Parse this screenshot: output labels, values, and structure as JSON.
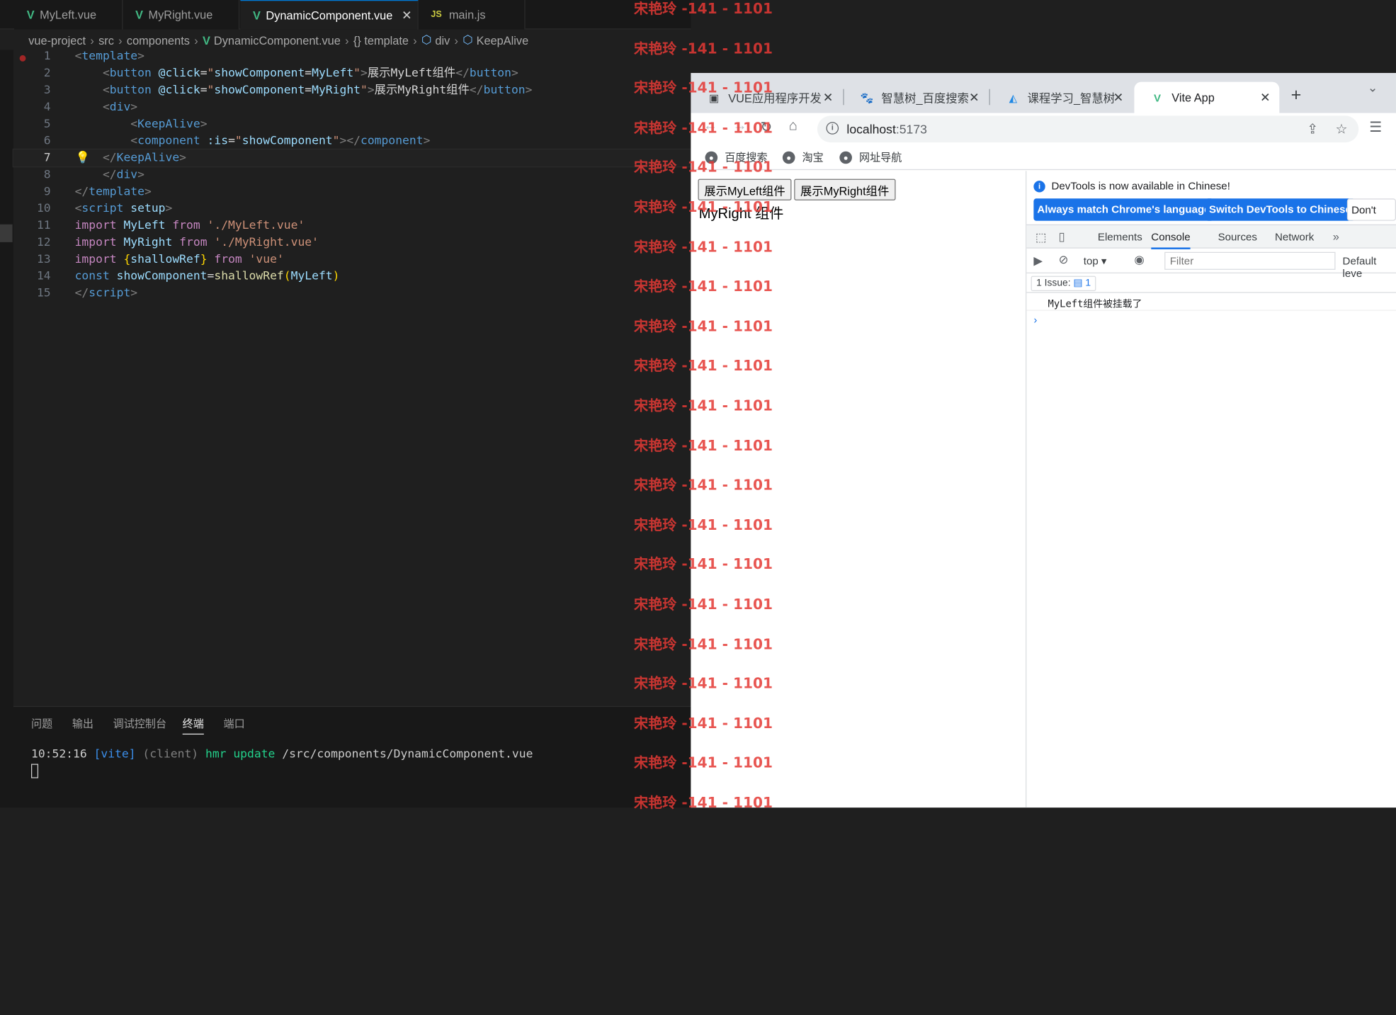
{
  "editor": {
    "tabs": [
      {
        "label": "MyLeft.vue",
        "icon": "vue-icon"
      },
      {
        "label": "MyRight.vue",
        "icon": "vue-icon"
      },
      {
        "label": "DynamicComponent.vue",
        "icon": "vue-icon",
        "active": true
      },
      {
        "label": "main.js",
        "icon": "js-icon",
        "icon_text": "JS"
      }
    ],
    "breadcrumb": [
      "vue-project",
      "src",
      "components",
      "DynamicComponent.vue",
      "{} template",
      "div",
      "KeepAlive"
    ],
    "code_lines": [
      {
        "n": "1",
        "parts": [
          [
            "tag",
            "<"
          ],
          [
            "tn",
            "template"
          ],
          [
            "tag",
            ">"
          ]
        ]
      },
      {
        "n": "2",
        "parts": [
          [
            "plain",
            "    "
          ],
          [
            "tag",
            "<"
          ],
          [
            "tn",
            "button"
          ],
          [
            "plain",
            " "
          ],
          [
            "at",
            "@click"
          ],
          [
            "plain",
            "="
          ],
          [
            "str",
            "\""
          ],
          [
            "id",
            "showComponent"
          ],
          [
            "plain",
            "="
          ],
          [
            "id",
            "MyLeft"
          ],
          [
            "str",
            "\""
          ],
          [
            "tag",
            ">"
          ],
          [
            "plain",
            "展示MyLeft组件"
          ],
          [
            "tag",
            "</"
          ],
          [
            "tn",
            "button"
          ],
          [
            "tag",
            ">"
          ]
        ]
      },
      {
        "n": "3",
        "parts": [
          [
            "plain",
            "    "
          ],
          [
            "tag",
            "<"
          ],
          [
            "tn",
            "button"
          ],
          [
            "plain",
            " "
          ],
          [
            "at",
            "@click"
          ],
          [
            "plain",
            "="
          ],
          [
            "str",
            "\""
          ],
          [
            "id",
            "showComponent"
          ],
          [
            "plain",
            "="
          ],
          [
            "id",
            "MyRight"
          ],
          [
            "str",
            "\""
          ],
          [
            "tag",
            ">"
          ],
          [
            "plain",
            "展示MyRight组件"
          ],
          [
            "tag",
            "</"
          ],
          [
            "tn",
            "button"
          ],
          [
            "tag",
            ">"
          ]
        ]
      },
      {
        "n": "4",
        "parts": [
          [
            "plain",
            "    "
          ],
          [
            "tag",
            "<"
          ],
          [
            "tn",
            "div"
          ],
          [
            "tag",
            ">"
          ]
        ]
      },
      {
        "n": "5",
        "parts": [
          [
            "plain",
            "        "
          ],
          [
            "tag",
            "<"
          ],
          [
            "tn",
            "KeepAlive"
          ],
          [
            "tag",
            ">"
          ]
        ]
      },
      {
        "n": "6",
        "parts": [
          [
            "plain",
            "        "
          ],
          [
            "tag",
            "<"
          ],
          [
            "tn",
            "component"
          ],
          [
            "plain",
            " "
          ],
          [
            "at",
            ":is"
          ],
          [
            "plain",
            "="
          ],
          [
            "str",
            "\""
          ],
          [
            "id",
            "showComponent"
          ],
          [
            "str",
            "\""
          ],
          [
            "tag",
            "></"
          ],
          [
            "tn",
            "component"
          ],
          [
            "tag",
            ">"
          ]
        ]
      },
      {
        "n": "7",
        "parts": [
          [
            "plain",
            "    "
          ],
          [
            "tag",
            "</"
          ],
          [
            "tn",
            "KeepAlive"
          ],
          [
            "tag",
            ">"
          ]
        ]
      },
      {
        "n": "8",
        "parts": [
          [
            "plain",
            "    "
          ],
          [
            "tag",
            "</"
          ],
          [
            "tn",
            "div"
          ],
          [
            "tag",
            ">"
          ]
        ]
      },
      {
        "n": "9",
        "parts": [
          [
            "tag",
            "</"
          ],
          [
            "tn",
            "template"
          ],
          [
            "tag",
            ">"
          ]
        ]
      },
      {
        "n": "10",
        "parts": [
          [
            "tag",
            "<"
          ],
          [
            "tn",
            "script"
          ],
          [
            "plain",
            " "
          ],
          [
            "at",
            "setup"
          ],
          [
            "tag",
            ">"
          ]
        ]
      },
      {
        "n": "11",
        "parts": [
          [
            "kw",
            "import"
          ],
          [
            "plain",
            " "
          ],
          [
            "id",
            "MyLeft"
          ],
          [
            "plain",
            " "
          ],
          [
            "kw",
            "from"
          ],
          [
            "plain",
            " "
          ],
          [
            "str",
            "'./MyLeft.vue'"
          ]
        ]
      },
      {
        "n": "12",
        "parts": [
          [
            "kw",
            "import"
          ],
          [
            "plain",
            " "
          ],
          [
            "id",
            "MyRight"
          ],
          [
            "plain",
            " "
          ],
          [
            "kw",
            "from"
          ],
          [
            "plain",
            " "
          ],
          [
            "str",
            "'./MyRight.vue'"
          ]
        ]
      },
      {
        "n": "13",
        "parts": [
          [
            "kw",
            "import"
          ],
          [
            "plain",
            " "
          ],
          [
            "br",
            "{"
          ],
          [
            "id",
            "shallowRef"
          ],
          [
            "br",
            "}"
          ],
          [
            "plain",
            " "
          ],
          [
            "kw",
            "from"
          ],
          [
            "plain",
            " "
          ],
          [
            "str",
            "'vue'"
          ]
        ]
      },
      {
        "n": "14",
        "parts": [
          [
            "dec",
            "const"
          ],
          [
            "plain",
            " "
          ],
          [
            "id",
            "showComponent"
          ],
          [
            "plain",
            "="
          ],
          [
            "fn",
            "shallowRef"
          ],
          [
            "br",
            "("
          ],
          [
            "id",
            "MyLeft"
          ],
          [
            "br",
            ")"
          ]
        ]
      },
      {
        "n": "15",
        "parts": [
          [
            "tag",
            "</"
          ],
          [
            "tn",
            "script"
          ],
          [
            "tag",
            ">"
          ]
        ]
      }
    ],
    "current_line": "7",
    "panel_tabs": [
      "问题",
      "输出",
      "调试控制台",
      "终端",
      "端口"
    ],
    "panel_active": "终端",
    "terminal": {
      "time": "10:52:16",
      "tag": "[vite]",
      "client": "(client)",
      "hmr": "hmr update",
      "path": "/src/components/DynamicComponent.vue"
    }
  },
  "browser": {
    "tabs": [
      "VUE应用程序开发",
      "智慧树_百度搜索",
      "课程学习_智慧树",
      "Vite App"
    ],
    "active_tab": "Vite App",
    "url_host": "localhost",
    "url_port": ":5173",
    "bookmarks": [
      "百度搜索",
      "淘宝",
      "网址导航"
    ],
    "page": {
      "buttons": [
        "展示MyLeft组件",
        "展示MyRight组件"
      ],
      "text": "MyRight 组件"
    },
    "devtools": {
      "notice": "DevTools is now available in Chinese!",
      "btn_match": "Always match Chrome's language",
      "btn_switch": "Switch DevTools to Chinese",
      "btn_dont": "Don't sho",
      "tabs": [
        "Elements",
        "Console",
        "Sources",
        "Network"
      ],
      "active_tab": "Console",
      "context": "top",
      "filter_placeholder": "Filter",
      "levels": "Default leve",
      "issues": "1 Issue:",
      "issues_count": "1",
      "console_message": "MyLeft组件被挂载了"
    }
  },
  "watermark": "宋艳玲 -141 - 1101"
}
